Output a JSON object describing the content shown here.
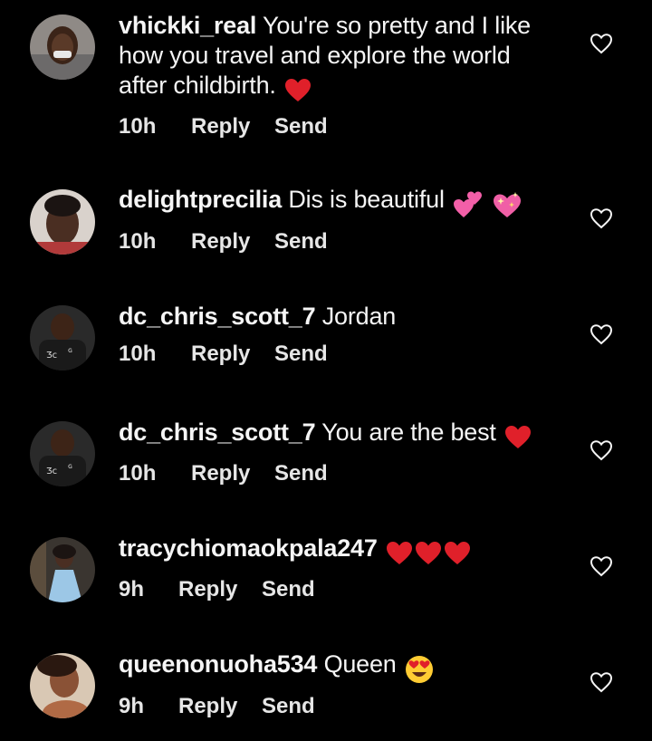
{
  "comments": [
    {
      "username": "vhickki_real",
      "text": "You're so pretty and I like how you travel and explore the world after childbirth.",
      "emoji": [
        "red-heart"
      ],
      "time": "10h",
      "reply_label": "Reply",
      "send_label": "Send"
    },
    {
      "username": "delightprecilia",
      "text": "Dis is beautiful",
      "emoji": [
        "two-hearts",
        "sparkling-heart"
      ],
      "time": "10h",
      "reply_label": "Reply",
      "send_label": "Send"
    },
    {
      "username": "dc_chris_scott_7",
      "text": "Jordan",
      "emoji": [],
      "time": "10h",
      "reply_label": "Reply",
      "send_label": "Send"
    },
    {
      "username": "dc_chris_scott_7",
      "text": "You are the best",
      "emoji": [
        "red-heart"
      ],
      "time": "10h",
      "reply_label": "Reply",
      "send_label": "Send"
    },
    {
      "username": "tracychiomaokpala247",
      "text": "",
      "emoji": [
        "red-heart",
        "red-heart",
        "red-heart"
      ],
      "time": "9h",
      "reply_label": "Reply",
      "send_label": "Send"
    },
    {
      "username": "queenonuoha534",
      "text": "Queen",
      "emoji": [
        "heart-eyes-face"
      ],
      "time": "9h",
      "reply_label": "Reply",
      "send_label": "Send"
    }
  ],
  "colors": {
    "background": "#000000",
    "text": "#f5f5f5",
    "heart": "#e0202a"
  }
}
